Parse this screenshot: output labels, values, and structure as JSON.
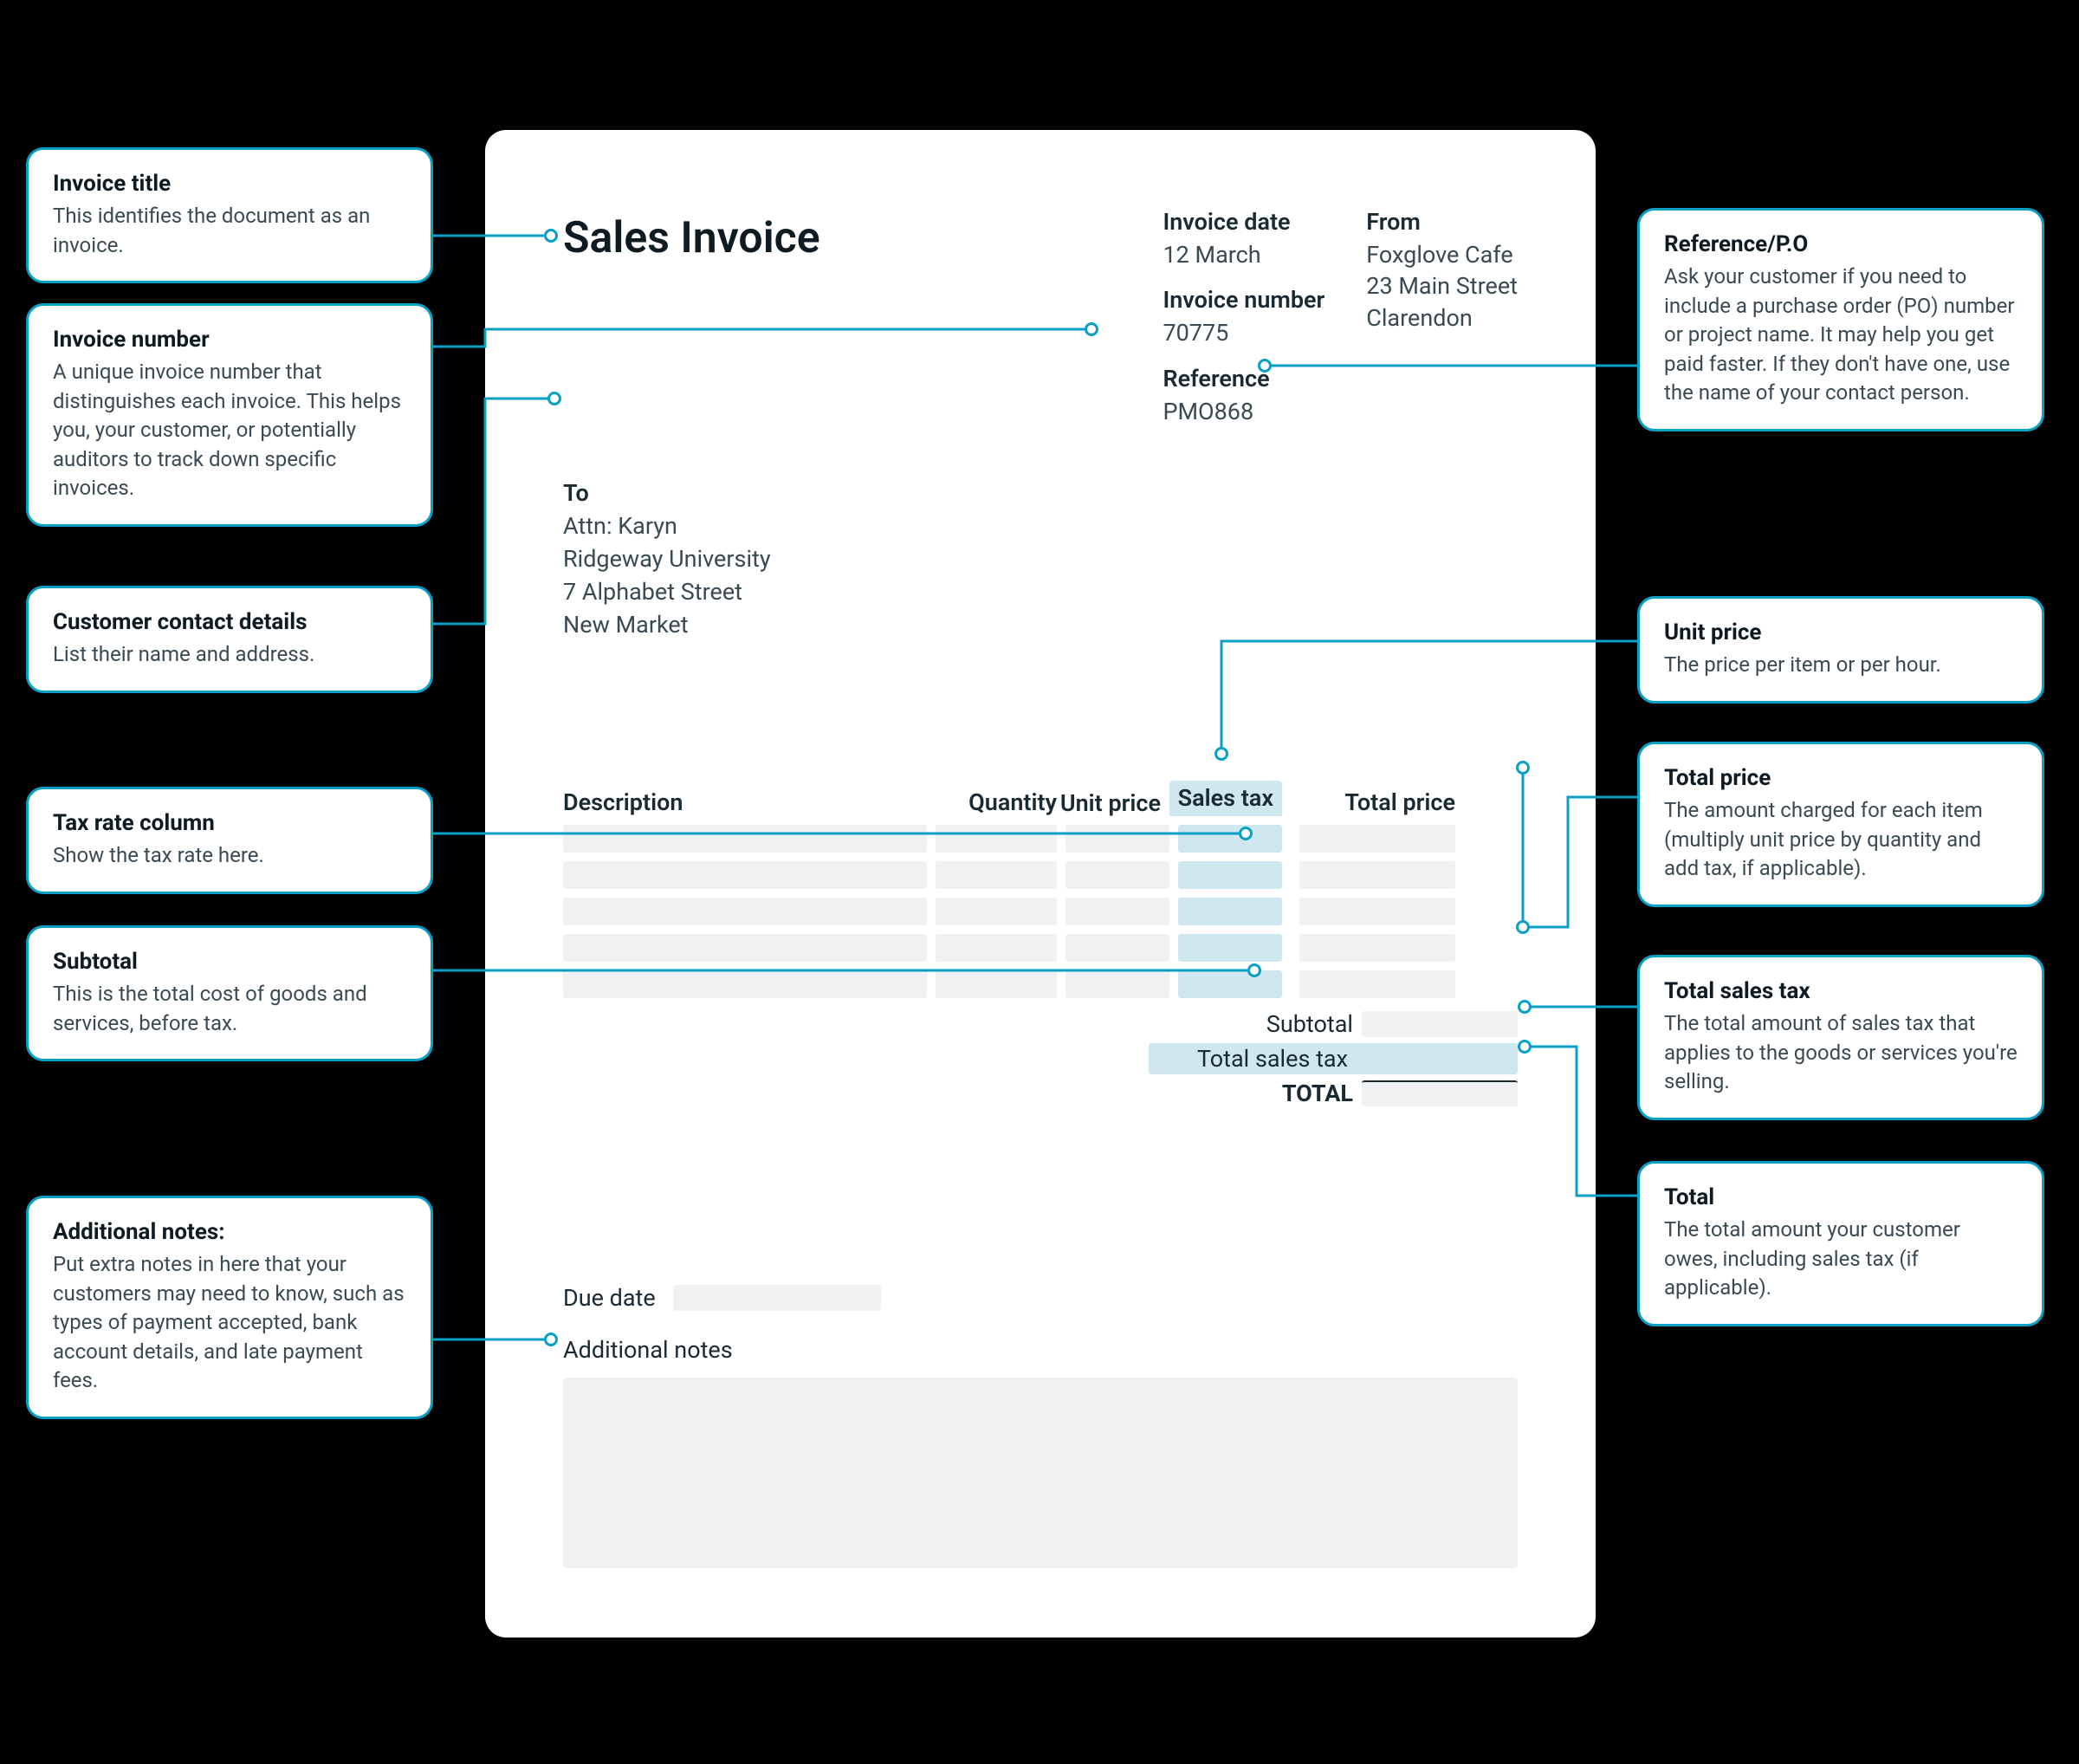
{
  "invoice": {
    "title": "Sales Invoice",
    "date_label": "Invoice date",
    "date_value": "12 March",
    "number_label": "Invoice number",
    "number_value": "70775",
    "reference_label": "Reference",
    "reference_value": "PMO868",
    "from_label": "From",
    "from_value": "Foxglove Cafe\n23 Main Street\nClarendon",
    "to_label": "To",
    "to_value": "Attn: Karyn\nRidgeway University\n7 Alphabet Street\nNew Market",
    "columns": {
      "description": "Description",
      "quantity": "Quantity",
      "unit_price": "Unit price",
      "sales_tax": "Sales tax",
      "total_price": "Total price"
    },
    "totals": {
      "subtotal": "Subtotal",
      "total_sales_tax": "Total sales tax",
      "total": "TOTAL"
    },
    "due_date_label": "Due date",
    "notes_label": "Additional notes"
  },
  "callouts": {
    "invoice_title": {
      "title": "Invoice title",
      "body": "This identifies the document as an invoice."
    },
    "invoice_number": {
      "title": "Invoice number",
      "body": "A unique invoice number that distinguishes each invoice. This helps you, your customer, or potentially auditors to track down specific invoices."
    },
    "customer_contact": {
      "title": "Customer contact details",
      "body": "List their name and address."
    },
    "tax_rate": {
      "title": "Tax rate column",
      "body": "Show the tax rate here."
    },
    "subtotal": {
      "title": "Subtotal",
      "body": "This is the total cost of goods and services, before tax."
    },
    "additional_notes": {
      "title": "Additional notes:",
      "body": "Put extra notes in here that your customers may need to know, such as types of payment accepted, bank account details, and late payment fees."
    },
    "reference_po": {
      "title": "Reference/P.O",
      "body": "Ask your customer if you need to include a purchase order (PO) number or project name. It may help you get paid faster. If they don't have one, use the name of your contact person."
    },
    "unit_price": {
      "title": "Unit price",
      "body": "The price per item or per hour."
    },
    "total_price": {
      "title": "Total price",
      "body": "The amount charged for each item (multiply unit price by quantity and add tax, if applicable)."
    },
    "total_sales_tax": {
      "title": "Total sales tax",
      "body": "The total amount of sales tax that applies to the goods or services you're selling."
    },
    "total": {
      "title": "Total",
      "body": "The total amount your customer owes, including sales tax (if applicable)."
    }
  }
}
